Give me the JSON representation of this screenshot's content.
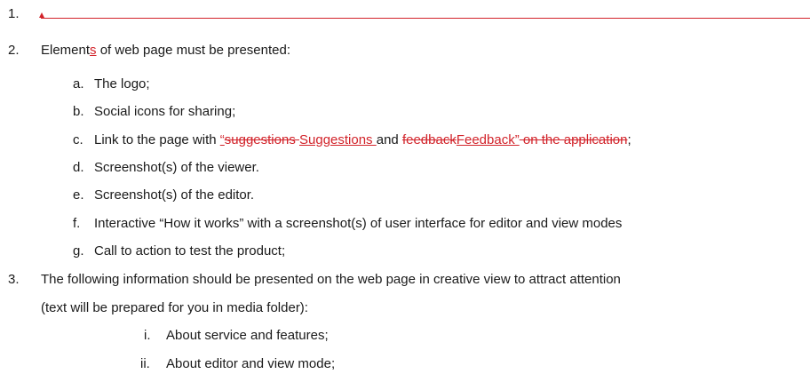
{
  "list": {
    "item1": {
      "number": "1."
    },
    "item2": {
      "number": "2.",
      "text_a": "Element",
      "text_ins": "s",
      "text_b": " of web page must be presented:",
      "subitems": {
        "a": {
          "letter": "a.",
          "text": "The logo;"
        },
        "b": {
          "letter": "b.",
          "text": "Social icons for sharing;"
        },
        "c": {
          "letter": "c.",
          "t1": "Link to the page with ",
          "ins1": "“",
          "del1": "suggestions ",
          "ins2": "Suggestions ",
          "t2": "and ",
          "del2": "feedback",
          "ins3": "Feedback”",
          "del3": " on the application",
          "t3": ";"
        },
        "d": {
          "letter": "d.",
          "text": "Screenshot(s) of the viewer."
        },
        "e": {
          "letter": "e.",
          "text": "Screenshot(s) of the editor."
        },
        "f": {
          "letter": "f.",
          "text": "Interactive “How it works” with a screenshot(s) of user interface for editor and view modes"
        },
        "g": {
          "letter": "g.",
          "text": "Call to action to test the product;"
        }
      }
    },
    "item3": {
      "number": "3.",
      "line1": "The following information should be presented on the web page in creative view to attract attention",
      "line2": "(text will be prepared for you in media folder):",
      "subitems": {
        "i": {
          "letter": "i.",
          "text": "About service and features;"
        },
        "ii": {
          "letter": "ii.",
          "text": "About editor and view mode;"
        }
      }
    }
  },
  "colors": {
    "revision": "#d2232a",
    "text": "#1a1a1a"
  }
}
